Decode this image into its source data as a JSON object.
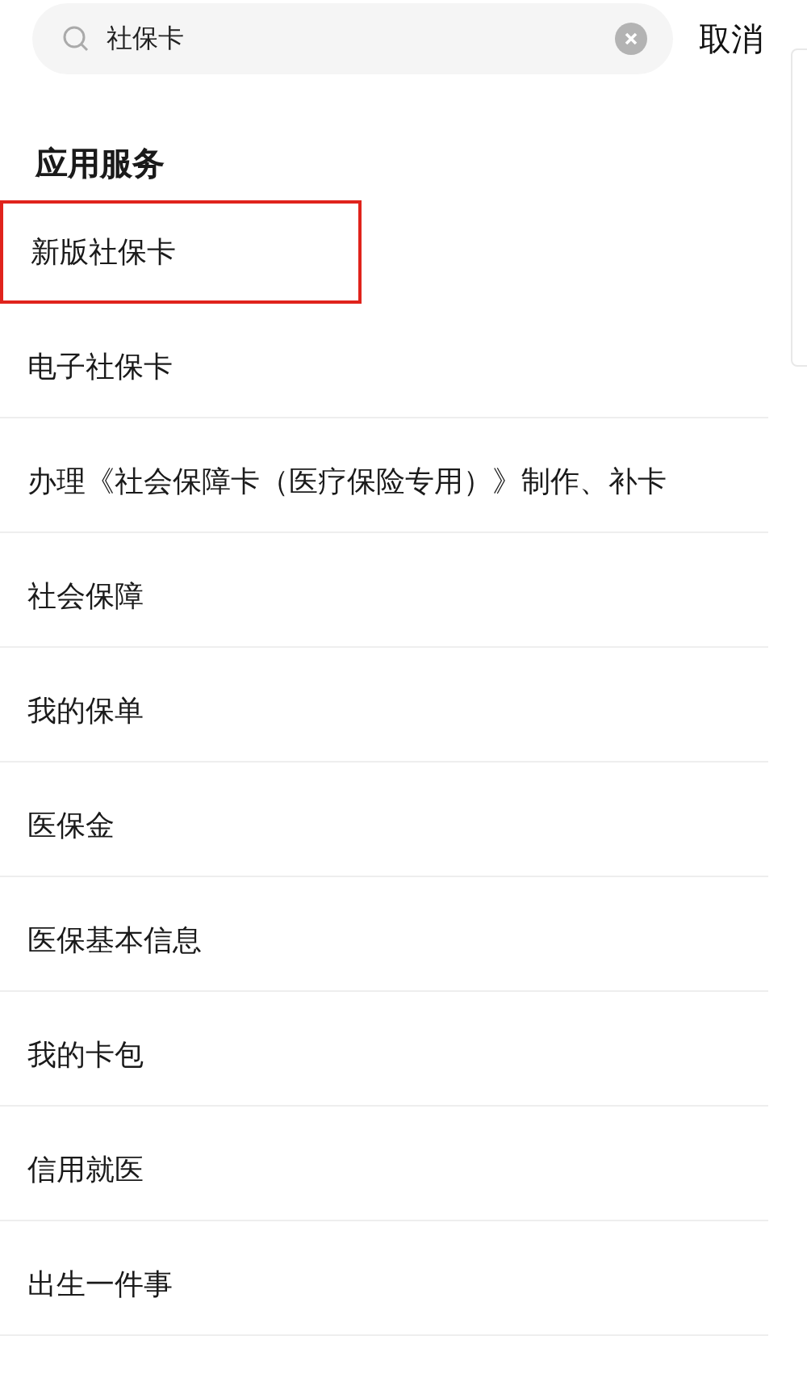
{
  "search": {
    "value": "社保卡"
  },
  "cancel": "取消",
  "section": {
    "title": "应用服务"
  },
  "results": [
    {
      "label": "新版社保卡",
      "highlighted": true
    },
    {
      "label": "电子社保卡",
      "highlighted": false
    },
    {
      "label": "办理《社会保障卡（医疗保险专用）》制作、补卡",
      "highlighted": false
    },
    {
      "label": "社会保障",
      "highlighted": false
    },
    {
      "label": "我的保单",
      "highlighted": false
    },
    {
      "label": "医保金",
      "highlighted": false
    },
    {
      "label": "医保基本信息",
      "highlighted": false
    },
    {
      "label": "我的卡包",
      "highlighted": false
    },
    {
      "label": "信用就医",
      "highlighted": false
    },
    {
      "label": "出生一件事",
      "highlighted": false
    }
  ]
}
